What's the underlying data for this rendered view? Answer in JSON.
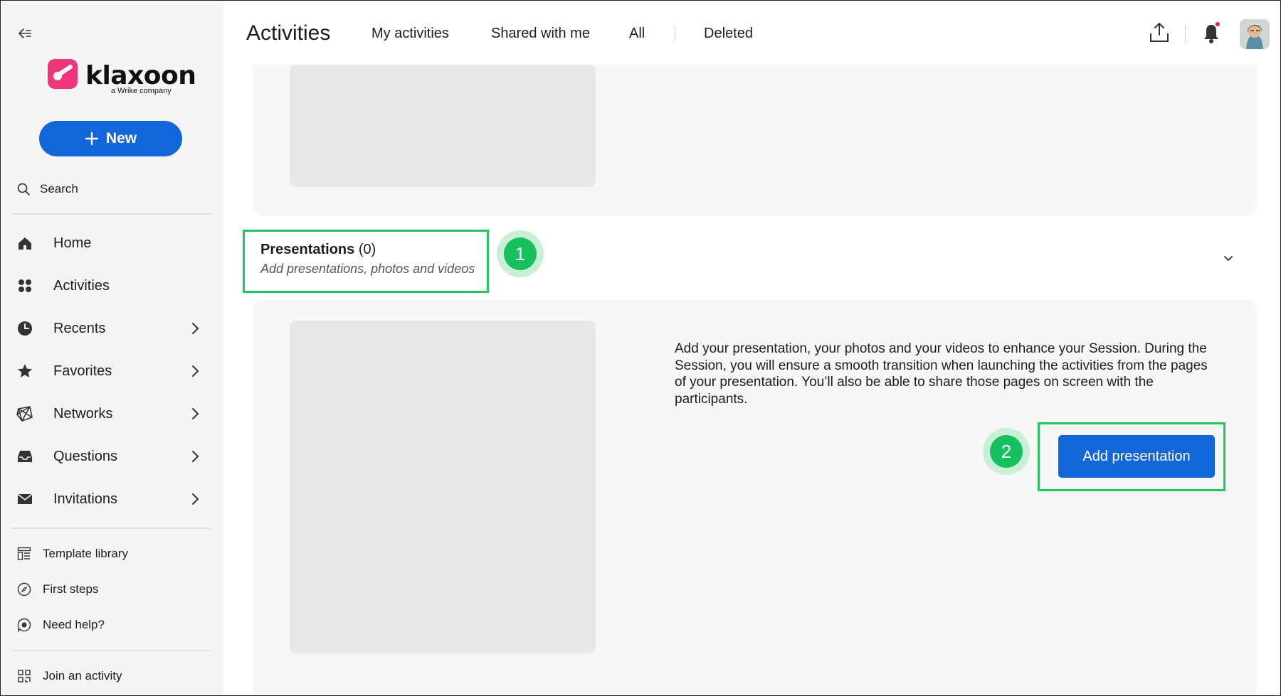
{
  "brand": {
    "name": "klaxoon",
    "tagline": "a Wrike company",
    "logo_color": "#f0367a"
  },
  "colors": {
    "accent": "#1266d9",
    "highlight": "#22c55e",
    "notification_dot": "#e11d48"
  },
  "sidebar": {
    "new_button": "New",
    "search_label": "Search",
    "items": [
      {
        "label": "Home",
        "icon": "home-icon",
        "has_chevron": false
      },
      {
        "label": "Activities",
        "icon": "activities-icon",
        "has_chevron": false
      },
      {
        "label": "Recents",
        "icon": "clock-icon",
        "has_chevron": true
      },
      {
        "label": "Favorites",
        "icon": "star-icon",
        "has_chevron": true
      },
      {
        "label": "Networks",
        "icon": "network-icon",
        "has_chevron": true
      },
      {
        "label": "Questions",
        "icon": "inbox-icon",
        "has_chevron": true
      },
      {
        "label": "Invitations",
        "icon": "envelope-icon",
        "has_chevron": true
      }
    ],
    "secondary": [
      {
        "label": "Template library",
        "icon": "template-icon"
      },
      {
        "label": "First steps",
        "icon": "compass-icon"
      },
      {
        "label": "Need help?",
        "icon": "help-icon"
      }
    ],
    "join_label": "Join an activity"
  },
  "header": {
    "title": "Activities",
    "tabs": [
      "My activities",
      "Shared with me",
      "All",
      "Deleted"
    ]
  },
  "section": {
    "title": "Presentations",
    "count": "(0)",
    "subtitle": "Add presentations, photos and videos",
    "description": "Add your presentation, your photos and your videos to enhance your Session. During the Session, you will ensure a smooth transition when launching the activities from the pages of your presentation. You’ll also be able to share those pages on screen with the participants.",
    "add_button": "Add presentation"
  },
  "steps": [
    "1",
    "2"
  ]
}
